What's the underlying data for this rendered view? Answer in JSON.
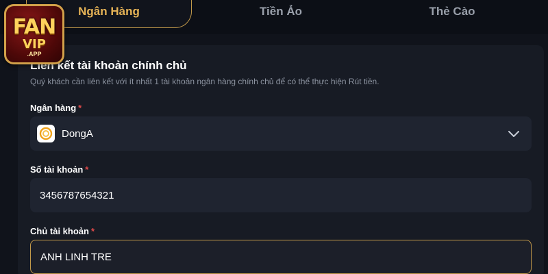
{
  "logo": {
    "line1": "FAN",
    "line2": "VIP",
    "line3": ".APP"
  },
  "tabs": [
    {
      "label": "Ngân Hàng",
      "active": true
    },
    {
      "label": "Tiền Ảo",
      "active": false
    },
    {
      "label": "Thẻ Cào",
      "active": false
    }
  ],
  "form": {
    "title": "Liên kết tài khoản chính chủ",
    "description": "Quý khách cần liên kết với ít nhất 1 tài khoản ngân hàng chính chủ để có thể thực hiện Rút tiền.",
    "required_mark": "*",
    "bank": {
      "label": "Ngân hàng",
      "value": "DongA",
      "icon": "donga-bank-icon"
    },
    "account_number": {
      "label": "Số tài khoản",
      "value": "3456787654321"
    },
    "account_holder": {
      "label": "Chủ tài khoản",
      "value": "ANH LINH TRE"
    }
  },
  "colors": {
    "accent": "#e6b356",
    "border_accent": "#c39a4a",
    "required": "#e04a4a",
    "background": "#10131b",
    "card": "#171b24",
    "input": "#1f2430"
  }
}
